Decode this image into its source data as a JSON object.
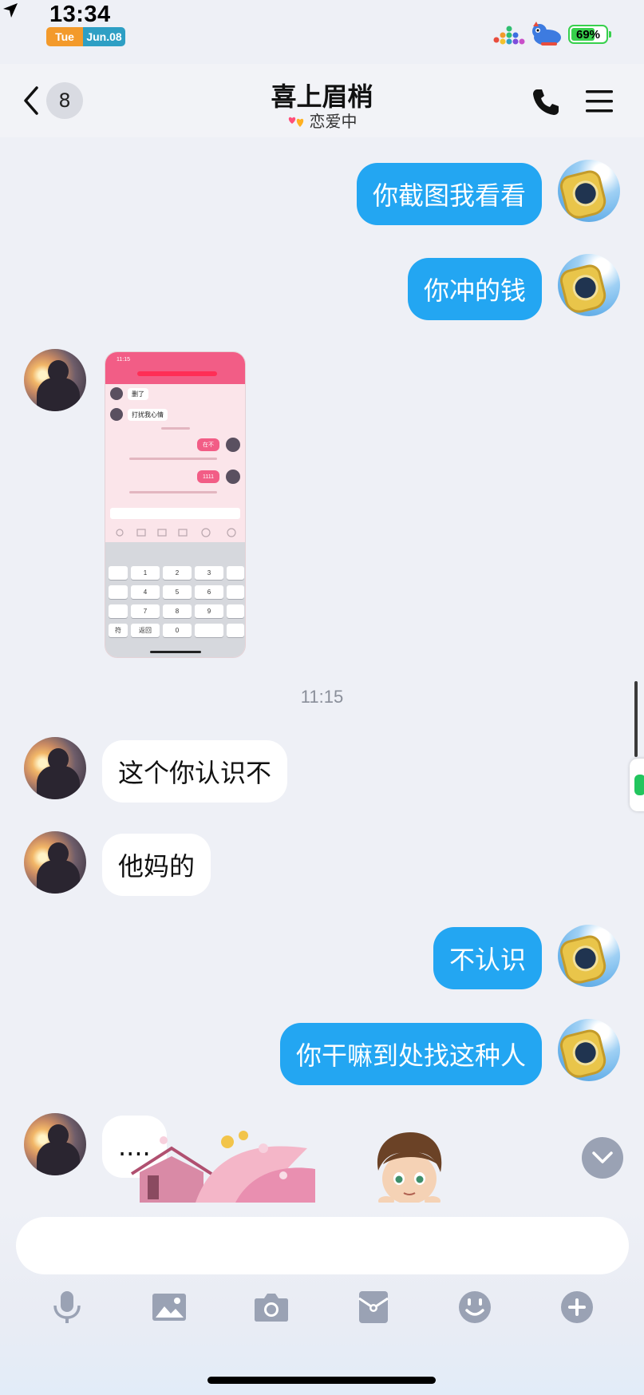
{
  "status_bar": {
    "time": "13:34",
    "day": "Tue",
    "date": "Jun.08",
    "battery_percent": "69%",
    "battery_level": 0.69
  },
  "header": {
    "unread_count": "8",
    "title": "喜上眉梢",
    "relationship_status": "恋爱中"
  },
  "messages": [
    {
      "side": "self",
      "text": "你截图我看看"
    },
    {
      "side": "self",
      "text": "你冲的钱"
    },
    {
      "side": "other",
      "type": "image"
    },
    {
      "type": "time",
      "text": "11:15"
    },
    {
      "side": "other",
      "text": "这个你认识不"
    },
    {
      "side": "other",
      "text": "他妈的"
    },
    {
      "side": "self",
      "text": "不认识"
    },
    {
      "side": "self",
      "text": "你干嘛到处找这种人"
    },
    {
      "side": "other",
      "text": "...."
    }
  ],
  "screenshot_content": {
    "time": "11:15",
    "rows": [
      "删了",
      "打扰我心情"
    ],
    "sent": [
      "在不",
      "1111"
    ],
    "keys": [
      "1",
      "2",
      "3",
      "4",
      "5",
      "6",
      "7",
      "8",
      "9",
      "0",
      "符",
      "返回"
    ]
  },
  "colors": {
    "self_bubble": "#23a6f2",
    "other_bubble": "#ffffff",
    "background": "#eef0f6",
    "battery": "#37d04c"
  },
  "icons": {
    "toolbar": [
      "microphone-icon",
      "image-icon",
      "camera-icon",
      "red-packet-icon",
      "emoji-icon",
      "plus-icon"
    ]
  }
}
